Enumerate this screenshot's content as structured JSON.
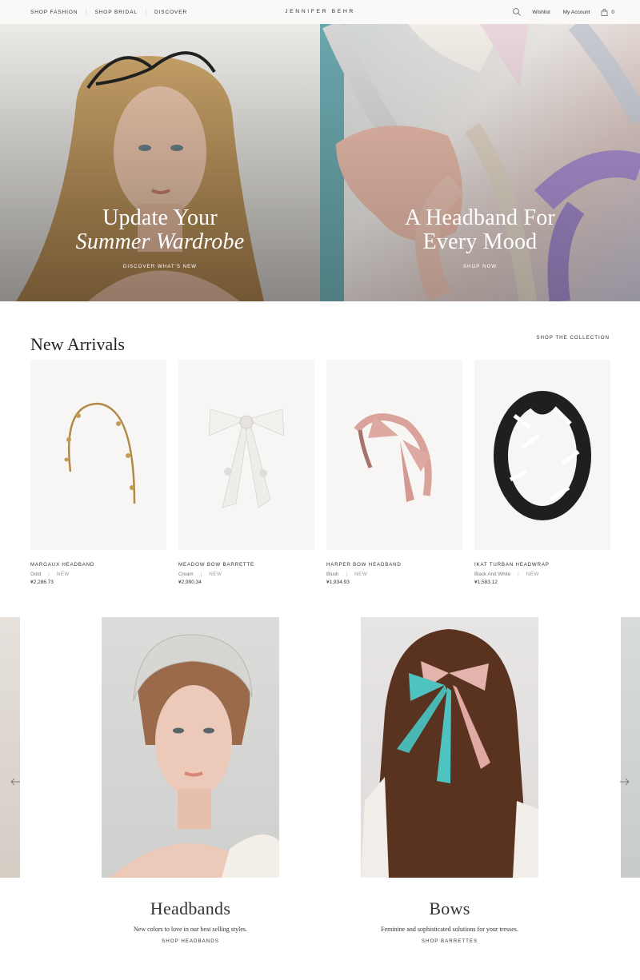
{
  "header": {
    "nav": [
      "SHOP FASHION",
      "SHOP BRIDAL",
      "DISCOVER"
    ],
    "brand": "JENNIFER BEHR",
    "wishlist": "Wishlist",
    "account": "My Account",
    "bag_count": "0"
  },
  "hero": [
    {
      "line1": "Update Your",
      "line2": "Summer Wardrobe",
      "cta": "DISCOVER WHAT'S NEW"
    },
    {
      "line1": "A Headband For",
      "line2": "Every Mood",
      "cta": "SHOP NOW"
    }
  ],
  "new_arrivals": {
    "title": "New Arrivals",
    "shop_link": "SHOP THE COLLECTION",
    "products": [
      {
        "name": "MARGAUX HEADBAND",
        "color": "Gold",
        "badge": "NEW",
        "price": "¥2,286.73"
      },
      {
        "name": "MEADOW BOW BARRETTE",
        "color": "Cream",
        "badge": "NEW",
        "price": "¥2,990.34"
      },
      {
        "name": "HARPER BOW HEADBAND",
        "color": "Blush",
        "badge": "NEW",
        "price": "¥1,934.93"
      },
      {
        "name": "IKAT TURBAN HEADWRAP",
        "color": "Black And White",
        "badge": "NEW",
        "price": "¥1,583.12"
      }
    ]
  },
  "categories": [
    {
      "title": "Headbands",
      "desc": "New colors to love in our best selling styles.",
      "link": "SHOP HEADBANDS"
    },
    {
      "title": "Bows",
      "desc": "Feminine and sophisticated solutions for your tresses.",
      "link": "SHOP BARRETTES"
    }
  ],
  "icons": {
    "search": "search-icon",
    "bag": "shopping-bag-icon",
    "prev": "arrow-left-icon",
    "next": "arrow-right-icon"
  }
}
